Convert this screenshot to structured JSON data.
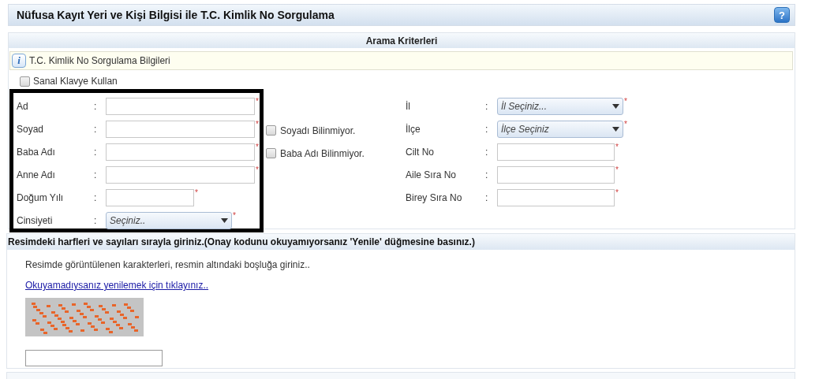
{
  "page_title": "Nüfusa Kayıt Yeri ve Kişi Bilgisi ile T.C. Kimlik No Sorgulama",
  "help_button": {
    "label": "?"
  },
  "criteria": {
    "title": "Arama Kriterleri",
    "info_icon": "i",
    "info": "T.C. Kimlik No Sorgulama Bilgileri",
    "virtual_keyboard": {
      "label": "Sanal Klavye Kullan",
      "checked": false
    },
    "left_fields": [
      {
        "kind": "text",
        "label": "Ad",
        "required": true
      },
      {
        "kind": "text",
        "label": "Soyad",
        "required": true,
        "option": {
          "label": "Soyadı Bilinmiyor.",
          "checked": false
        }
      },
      {
        "kind": "text",
        "label": "Baba Adı",
        "required": true,
        "option": {
          "label": "Baba Adı Bilinmiyor.",
          "checked": false
        }
      },
      {
        "kind": "text",
        "label": "Anne Adı",
        "required": true
      },
      {
        "kind": "short_text",
        "label": "Doğum Yılı",
        "required": true
      },
      {
        "kind": "select",
        "label": "Cinsiyeti",
        "placeholder": "Seçiniz..",
        "required": true
      }
    ],
    "right_fields": [
      {
        "kind": "select",
        "label": "İl",
        "placeholder": "İl Seçiniz...",
        "required": true
      },
      {
        "kind": "select",
        "label": "İlçe",
        "placeholder": "İlçe Seçiniz",
        "required": true
      },
      {
        "kind": "text",
        "label": "Cilt No",
        "required": true
      },
      {
        "kind": "text",
        "label": "Aile Sıra No",
        "required": true
      },
      {
        "kind": "text",
        "label": "Birey Sıra No",
        "required": true
      }
    ],
    "separator": ":",
    "required_mark": "*"
  },
  "captcha": {
    "title": "Resimdeki harfleri ve sayıları sırayla giriniz.(Onay kodunu okuyamıyorsanız 'Yenile' düğmesine basınız.)",
    "instruction": "Resimde görüntülenen karakterleri, resmin altındaki boşluğa giriniz..",
    "refresh_link": "Okuyamadıysanız yenilemek için tıklayınız.."
  }
}
